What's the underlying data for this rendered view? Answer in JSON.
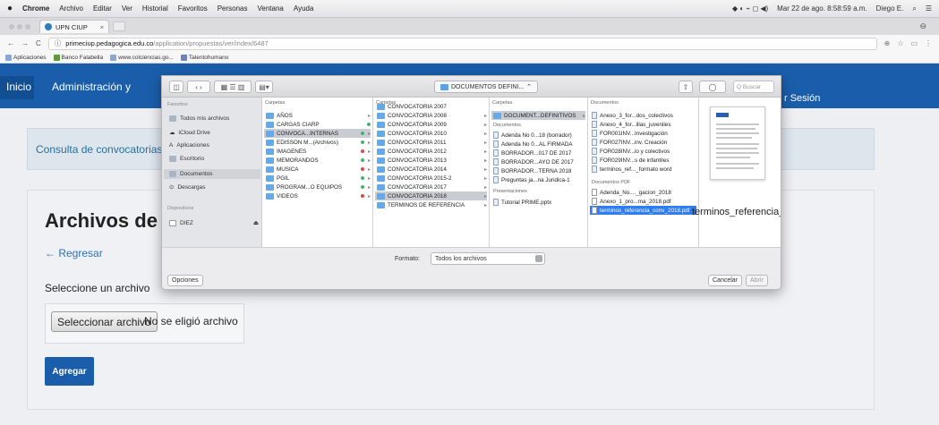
{
  "menubar": {
    "apple": "",
    "app": "Chrome",
    "items": [
      "Archivo",
      "Editar",
      "Ver",
      "Historial",
      "Favoritos",
      "Personas",
      "Ventana",
      "Ayuda"
    ],
    "clock": "Mar 22 de ago. 8:58:59 a.m.",
    "user": "Diego E."
  },
  "tab": {
    "title": "UPN CIUP",
    "close": "×"
  },
  "address": {
    "host": "primeciup.pedagogica.edu.co",
    "path": "/application/propuestas/ver/index/6487"
  },
  "bookmarks": [
    {
      "label": "Aplicaciones"
    },
    {
      "label": "Banco Falabella"
    },
    {
      "label": "www.colciencias.go..."
    },
    {
      "label": "Talentohumano"
    }
  ],
  "nav": {
    "home": "Inicio",
    "admin": "Administración y",
    "logout": "r Sesión"
  },
  "consulta": "Consulta de convocatorias",
  "page": {
    "title": "Archivos de Ir",
    "back": "Regresar",
    "select_label": "Seleccione un archivo",
    "file_button": "Seleccionar archivo",
    "file_status": "No se eligió archivo",
    "submit": "Agregar"
  },
  "dialog": {
    "location": "DOCUMENTOS DEFINI...",
    "search_placeholder": "Q Buscar",
    "sidebar": {
      "favorites_header": "Favoritos",
      "items": [
        "Todos mis archivos",
        "iCloud Drive",
        "Aplicaciones",
        "Escritorio",
        "Documentos",
        "Descargas"
      ],
      "devices_header": "Dispositivos",
      "devices": [
        "DIEZ"
      ]
    },
    "col1": {
      "header": "Carpetas",
      "items": [
        "AÑOS",
        "CARGAS CIARP",
        "CONVOCA...INTERNAS",
        "EDISSON M...(Archivos)",
        "IMAGENES",
        "MEMORANDOS",
        "MUSICA",
        "PGIL",
        "PROGRAM...O EQUIPOS",
        "VIDEOS"
      ]
    },
    "col2": {
      "header": "Carpetas",
      "items": [
        "CONVOCATORIA 2007",
        "CONVOCATORIA 2008",
        "CONVOCATORIA 2009",
        "CONVOCATORIA 2010",
        "CONVOCATORIA 2011",
        "CONVOCATORIA 2012",
        "CONVOCATORIA 2013",
        "CONVOCATORIA 2014",
        "CONVOCATORIA 2015-2",
        "CONVOCATORIA 2017",
        "CONVOCATORIA 2018",
        "TERMINOS DE REFERENCIA"
      ]
    },
    "col3": {
      "header": "Carpetas",
      "folder": "DOCUMENT...DEFINITIVOS",
      "docs_header": "Documentos",
      "docs": [
        "Adenda No 0...18 (borrador)",
        "Adenda No 0...AL FIRMADA",
        "BORRADOR...017 DE 2017",
        "BORRADOR...AYO DE 2017",
        "BORRADOR...TERNA 2018",
        "Preguntas ja...na Juridica-1"
      ],
      "pres_header": "Presentaciones",
      "pres": [
        "Tutorial PRIME.pptx"
      ]
    },
    "col4": {
      "header": "Documentos",
      "docs": [
        "Anexo_3_for...dos_colectivos",
        "Anexo_4_for...illas_juveniles",
        "FOR001INV...Investigación",
        "FOR027INV...inv. Creación",
        "FOR028INV...io y colectivos",
        "FOR029INV...s de infantiles",
        "terminos_ref..._formato word"
      ],
      "pdf_header": "Documentos PDF",
      "pdfs": [
        "Adenda_No...._gacion_2018",
        "Anexo_1_pro...ma_2018.pdf",
        "terminos_referencia_conv_2018.pdf"
      ]
    },
    "preview_name": "terminos_referencia_conv_2018.pdf",
    "format_label": "Formato:",
    "format_value": "Todos los archivos",
    "options": "Opciones",
    "cancel": "Cancelar",
    "open": "Abrir"
  }
}
